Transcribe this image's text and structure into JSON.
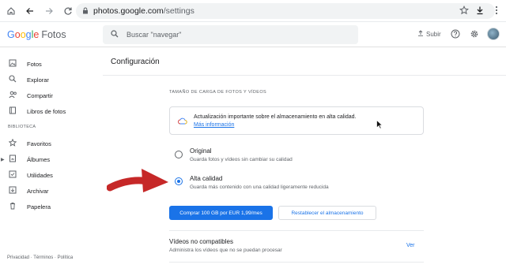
{
  "browser": {
    "url_host": "photos.google.com",
    "url_path": "/settings"
  },
  "app": {
    "logo_google": "Google",
    "logo_product": "Fotos",
    "search_placeholder": "Buscar \"navegar\"",
    "upload_label": "Subir"
  },
  "sidebar": {
    "items": [
      {
        "label": "Fotos",
        "icon": "photo-icon"
      },
      {
        "label": "Explorar",
        "icon": "search-icon"
      },
      {
        "label": "Compartir",
        "icon": "people-icon"
      },
      {
        "label": "Libros de fotos",
        "icon": "book-icon"
      }
    ],
    "section_label": "BIBLIOTECA",
    "library_items": [
      {
        "label": "Favoritos",
        "icon": "star-icon"
      },
      {
        "label": "Álbumes",
        "icon": "album-icon"
      },
      {
        "label": "Utilidades",
        "icon": "utilities-icon"
      },
      {
        "label": "Archivar",
        "icon": "archive-icon"
      },
      {
        "label": "Papelera",
        "icon": "trash-icon"
      }
    ],
    "footer": "Privacidad · Términos · Política"
  },
  "main": {
    "title": "Configuración",
    "section_title": "TAMAÑO DE CARGA DE FOTOS Y VÍDEOS",
    "notice_text": "Actualización importante sobre el almacenamiento en alta calidad.",
    "notice_link": "Más información",
    "options": [
      {
        "label": "Original",
        "desc": "Guarda fotos y vídeos sin cambiar su calidad",
        "selected": false
      },
      {
        "label": "Alta calidad",
        "desc": "Guarda más contenido con una calidad ligeramente reducida",
        "selected": true
      }
    ],
    "buy_button": "Comprar 100 GB por EUR 1,99/mes",
    "restore_button": "Restablecer el almacenamiento",
    "unsupported_title": "Vídeos no compatibles",
    "unsupported_desc": "Administra los vídeos que no se puedan procesar",
    "unsupported_link": "Ver"
  },
  "colors": {
    "accent": "#1a73e8",
    "annotation_arrow": "#c62828"
  }
}
